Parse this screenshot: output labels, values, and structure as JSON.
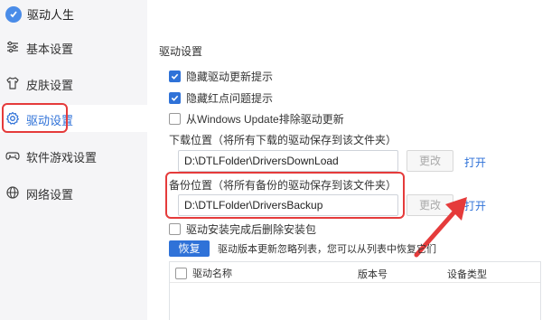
{
  "app": {
    "title": "驱动人生"
  },
  "sidebar": {
    "items": [
      {
        "label": "基本设置",
        "icon": "sliders-icon"
      },
      {
        "label": "皮肤设置",
        "icon": "shirt-icon"
      },
      {
        "label": "驱动设置",
        "icon": "gear-icon",
        "active": true
      },
      {
        "label": "软件游戏设置",
        "icon": "gamepad-icon"
      },
      {
        "label": "网络设置",
        "icon": "globe-icon"
      }
    ]
  },
  "main": {
    "section_title": "驱动设置",
    "options": [
      {
        "label": "隐藏驱动更新提示",
        "checked": true
      },
      {
        "label": "隐藏红点问题提示",
        "checked": true
      },
      {
        "label": "从Windows Update排除驱动更新",
        "checked": false
      }
    ],
    "download": {
      "label": "下载位置（将所有下载的驱动保存到该文件夹）",
      "path": "D:\\DTLFolder\\DriversDownLoad",
      "change_label": "更改",
      "open_label": "打开"
    },
    "backup": {
      "label": "备份位置（将所有备份的驱动保存到该文件夹）",
      "path": "D:\\DTLFolder\\DriversBackup",
      "change_label": "更改",
      "open_label": "打开"
    },
    "delete_after_install": {
      "label": "驱动安装完成后删除安装包",
      "checked": false
    },
    "restore": {
      "button_label": "恢复",
      "description": "驱动版本更新忽略列表，您可以从列表中恢复它们"
    },
    "table": {
      "columns": [
        "驱动名称",
        "版本号",
        "设备类型"
      ]
    }
  },
  "colors": {
    "accent": "#2f72d8",
    "highlight": "#e53b3b"
  }
}
